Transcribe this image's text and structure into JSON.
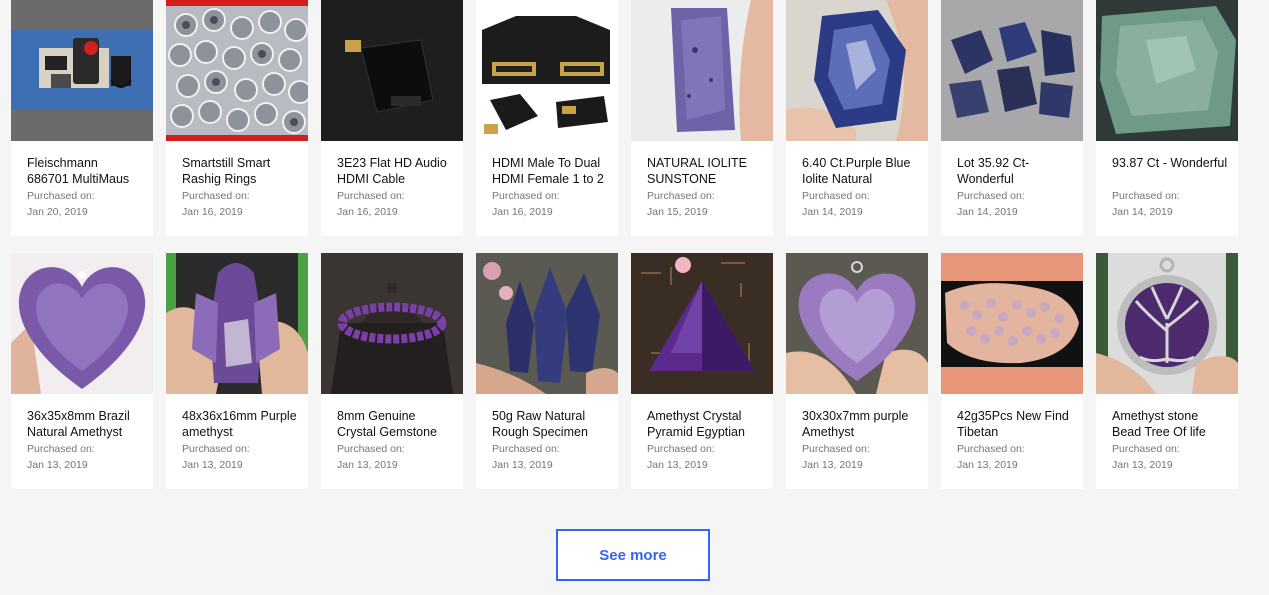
{
  "purchases": [
    {
      "title": "Fleischmann 686701 MultiMaus",
      "label": "Purchased on:",
      "date": "Jan 20, 2019",
      "image": "model-train-controller-icon"
    },
    {
      "title": "Smartstill Smart Rashig Rings",
      "label": "Purchased on:",
      "date": "Jan 16, 2019",
      "image": "rashig-rings-icon"
    },
    {
      "title": "3E23 Flat HD Audio HDMI Cable",
      "label": "Purchased on:",
      "date": "Jan 16, 2019",
      "image": "hdmi-adapter-icon"
    },
    {
      "title": "HDMI Male To Dual HDMI Female 1 to 2",
      "label": "Purchased on:",
      "date": "Jan 16, 2019",
      "image": "hdmi-splitter-icon"
    },
    {
      "title": "NATURAL IOLITE SUNSTONE",
      "label": "Purchased on:",
      "date": "Jan 15, 2019",
      "image": "iolite-slab-icon"
    },
    {
      "title": "6.40 Ct.Purple Blue Iolite Natural",
      "label": "Purchased on:",
      "date": "Jan 14, 2019",
      "image": "iolite-rough-icon"
    },
    {
      "title": "Lot 35.92 Ct- Wonderful",
      "label": "Purchased on:",
      "date": "Jan 14, 2019",
      "image": "gemstone-lot-icon"
    },
    {
      "title": "93.87 Ct - Wonderful",
      "label": "Purchased on:",
      "date": "Jan 14, 2019",
      "image": "green-stone-icon"
    },
    {
      "title": "36x35x8mm Brazil Natural Amethyst",
      "label": "Purchased on:",
      "date": "Jan 13, 2019",
      "image": "amethyst-heart-icon"
    },
    {
      "title": "48x36x16mm Purple amethyst",
      "label": "Purchased on:",
      "date": "Jan 13, 2019",
      "image": "amethyst-angel-icon"
    },
    {
      "title": "8mm Genuine Crystal Gemstone",
      "label": "Purchased on:",
      "date": "Jan 13, 2019",
      "image": "bead-bracelet-icon"
    },
    {
      "title": "50g Raw Natural Rough Specimen",
      "label": "Purchased on:",
      "date": "Jan 13, 2019",
      "image": "amethyst-points-icon"
    },
    {
      "title": "Amethyst Crystal Pyramid Egyptian",
      "label": "Purchased on:",
      "date": "Jan 13, 2019",
      "image": "amethyst-pyramid-icon"
    },
    {
      "title": "30x30x7mm purple Amethyst",
      "label": "Purchased on:",
      "date": "Jan 13, 2019",
      "image": "amethyst-pendant-icon"
    },
    {
      "title": "42g35Pcs New Find Tibetan",
      "label": "Purchased on:",
      "date": "Jan 13, 2019",
      "image": "crystal-chips-icon"
    },
    {
      "title": "Amethyst stone Bead Tree Of life",
      "label": "Purchased on:",
      "date": "Jan 13, 2019",
      "image": "tree-of-life-pendant-icon"
    }
  ],
  "see_more_label": "See more"
}
